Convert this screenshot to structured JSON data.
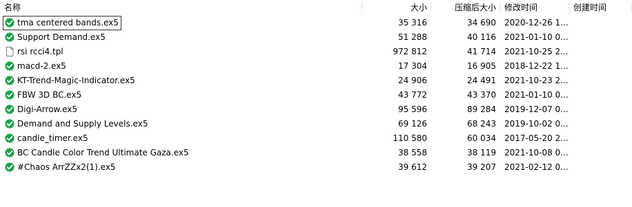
{
  "columns": {
    "name": "名称",
    "size": "大小",
    "compressed": "压缩后大小",
    "modified": "修改时间",
    "created": "创建时间"
  },
  "files": [
    {
      "name": "tma centered bands.ex5",
      "size": "35 316",
      "compressed": "34 690",
      "modified": "2020-12-26 1...",
      "icon": "verified-shield-icon"
    },
    {
      "name": "Support Demand.ex5",
      "size": "51 288",
      "compressed": "40 116",
      "modified": "2021-01-10 0...",
      "icon": "verified-shield-icon"
    },
    {
      "name": "rsi rcci4.tpl",
      "size": "972 812",
      "compressed": "41 714",
      "modified": "2021-10-25 2...",
      "icon": "document-icon"
    },
    {
      "name": "macd-2.ex5",
      "size": "17 304",
      "compressed": "16 905",
      "modified": "2018-12-22 1...",
      "icon": "verified-shield-icon"
    },
    {
      "name": "KT-Trend-Magic-Indicator.ex5",
      "size": "24 906",
      "compressed": "24 491",
      "modified": "2021-10-23 2...",
      "icon": "verified-shield-icon"
    },
    {
      "name": "FBW 3D BC.ex5",
      "size": "43 772",
      "compressed": "43 370",
      "modified": "2021-01-10 0...",
      "icon": "verified-shield-icon"
    },
    {
      "name": "Digi-Arrow.ex5",
      "size": "95 596",
      "compressed": "89 284",
      "modified": "2019-12-07 0...",
      "icon": "verified-shield-icon"
    },
    {
      "name": "Demand and Supply Levels.ex5",
      "size": "69 126",
      "compressed": "68 243",
      "modified": "2019-10-02 0...",
      "icon": "verified-shield-icon"
    },
    {
      "name": "candle_timer.ex5",
      "size": "110 580",
      "compressed": "60 034",
      "modified": "2017-05-20 2...",
      "icon": "verified-shield-icon"
    },
    {
      "name": "BC Candle Color Trend Ultimate Gaza.ex5",
      "size": "38 558",
      "compressed": "38 119",
      "modified": "2021-10-08 0...",
      "icon": "verified-shield-icon"
    },
    {
      "name": "#Chaos ArrZZx2(1).ex5",
      "size": "39 612",
      "compressed": "39 207",
      "modified": "2021-02-12 0...",
      "icon": "verified-shield-icon"
    }
  ],
  "colors": {
    "shield": "#1e9e4a",
    "check": "#ffffff",
    "focus_border": "#333333"
  }
}
